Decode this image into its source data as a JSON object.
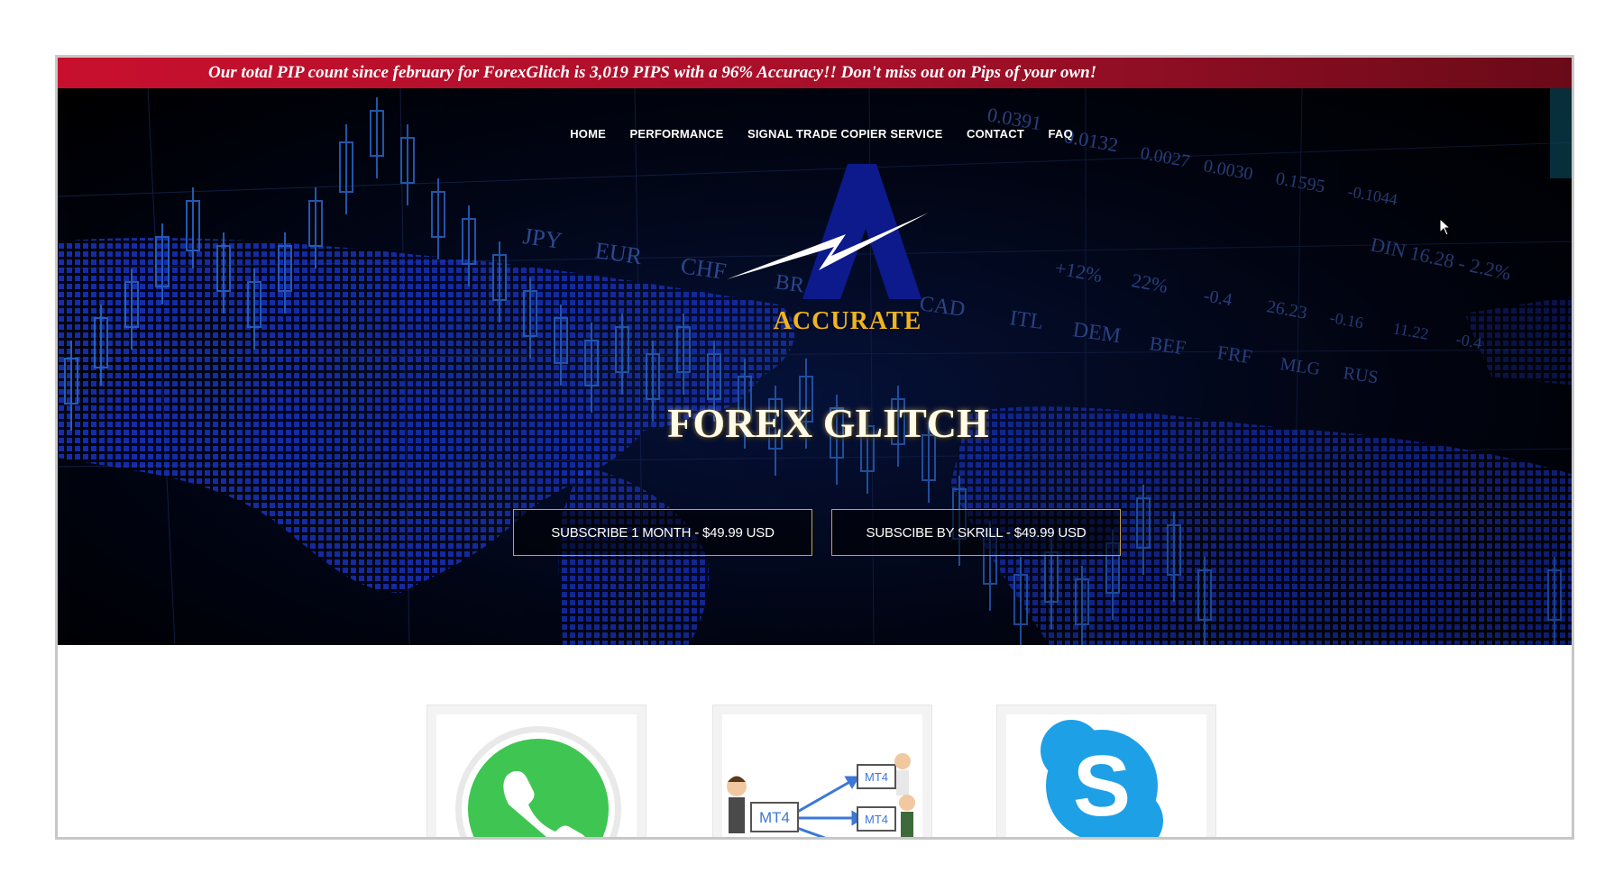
{
  "ticker": {
    "message": "Our total PIP count since february for ForexGlitch is 3,019 PIPS with a 96% Accuracy!!  Don't miss out on Pips of your own!"
  },
  "nav": {
    "items": [
      "HOME",
      "PERFORMANCE",
      "SIGNAL TRADE COPIER SERVICE",
      "CONTACT",
      "FAQ"
    ]
  },
  "hero": {
    "logo_text": "ACCURATE",
    "title": "FOREX GLITCH",
    "background_labels": [
      "JPY",
      "EUR",
      "CHF",
      "BR",
      "CAD",
      "ITL",
      "DEM",
      "BEF",
      "FRF",
      "MLG",
      "RUS",
      "+12%",
      "22%",
      "-0.4",
      "26.23",
      "-0.16",
      "11.22",
      "-0.4",
      "DIN 16.28 - 2.2%",
      "0.0391",
      "0.0132",
      "0.0027",
      "0.0030",
      "0.1595",
      "-0.1044"
    ],
    "buttons": {
      "subscribe_month": "SUBSCRIBE 1 MONTH - $49.99 USD",
      "subscribe_skrill": "SUBSCIBE BY SKRILL - $49.99 USD"
    }
  },
  "cards": {
    "copier_labels": [
      "MT4",
      "MT4",
      "MT4"
    ],
    "skype_letter": "S"
  },
  "colors": {
    "ticker_red": "#c8102e",
    "logo_gold": "#f0b51c",
    "logo_blue": "#0d1a8c",
    "whatsapp_green": "#3fc552",
    "skype_blue": "#1ea0e6"
  },
  "icons": [
    "cursor-arrow-icon",
    "whatsapp-icon",
    "mt4-copier-icon",
    "skype-icon",
    "lightning-bolt-icon"
  ]
}
